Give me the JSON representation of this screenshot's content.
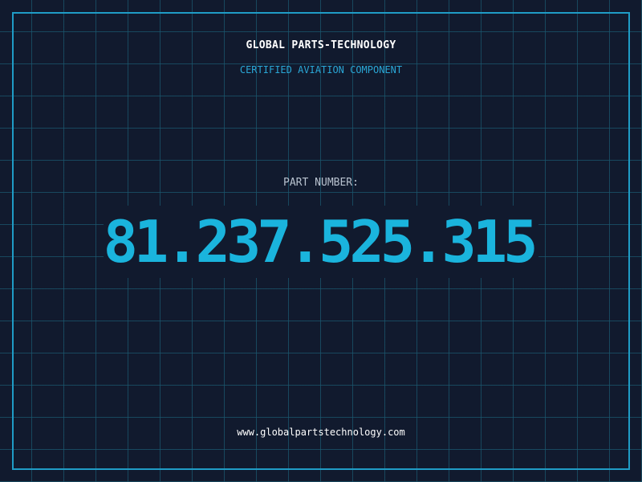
{
  "header": {
    "title": "GLOBAL PARTS-TECHNOLOGY",
    "subtitle": "CERTIFIED AVIATION COMPONENT"
  },
  "main": {
    "label": "PART NUMBER:",
    "part_number": "81.237.525.315"
  },
  "footer": {
    "url": "www.globalpartstechnology.com"
  },
  "colors": {
    "background": "#111a2e",
    "grid": "#1a566e",
    "frame": "#1f9cc6",
    "accent": "#1ab4dd",
    "title": "#ffffff",
    "label": "#b8c2cf"
  }
}
